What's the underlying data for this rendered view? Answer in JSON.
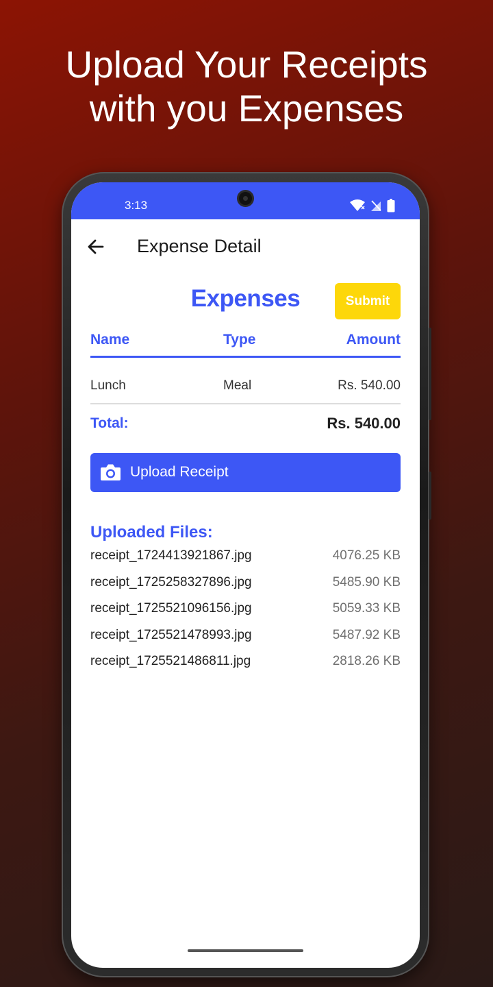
{
  "promo": {
    "headline_line1": "Upload Your Receipts",
    "headline_line2": "with you Expenses"
  },
  "status_bar": {
    "time": "3:13",
    "icons": [
      "wifi-icon",
      "no-sim-icon",
      "battery-icon"
    ]
  },
  "app_bar": {
    "back_icon": "arrow-left-icon",
    "title": "Expense Detail"
  },
  "expenses": {
    "title": "Expenses",
    "submit_label": "Submit",
    "columns": [
      "Name",
      "Type",
      "Amount"
    ],
    "rows": [
      {
        "name": "Lunch",
        "type": "Meal",
        "amount": "Rs. 540.00"
      }
    ],
    "total_label": "Total:",
    "total_value": "Rs. 540.00"
  },
  "upload": {
    "icon": "camera-icon",
    "label": "Upload Receipt"
  },
  "uploaded_files": {
    "title": "Uploaded Files:",
    "files": [
      {
        "name": "receipt_1724413921867.jpg",
        "size": "4076.25 KB"
      },
      {
        "name": "receipt_1725258327896.jpg",
        "size": "5485.90 KB"
      },
      {
        "name": "receipt_1725521096156.jpg",
        "size": "5059.33 KB"
      },
      {
        "name": "receipt_1725521478993.jpg",
        "size": "5487.92 KB"
      },
      {
        "name": "receipt_1725521486811.jpg",
        "size": "2818.26 KB"
      }
    ]
  },
  "colors": {
    "primary": "#3d57f5",
    "submit": "#fdd70a",
    "background_top": "#8c1404",
    "background_bottom": "#2a1a17"
  }
}
